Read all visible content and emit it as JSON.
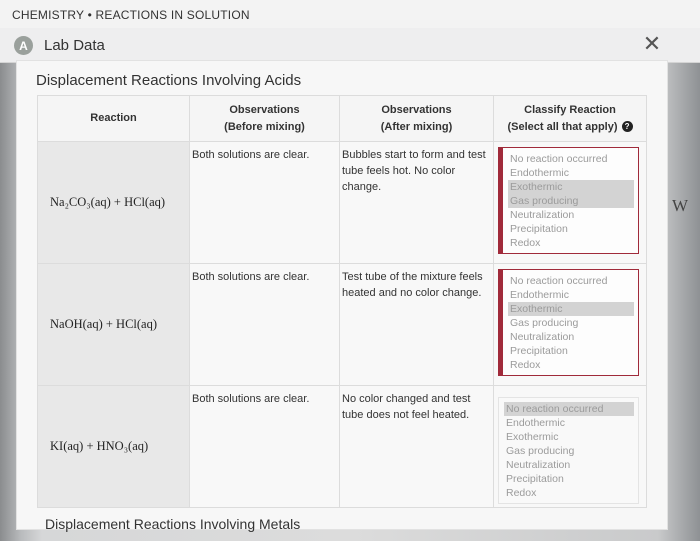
{
  "course_title": "CHEMISTRY • REACTIONS IN SOLUTION",
  "header": {
    "icon_letter": "A",
    "title": "Lab Data",
    "close": "✕"
  },
  "section_title": "Displacement Reactions Involving Acids",
  "columns": {
    "reaction": "Reaction",
    "before_1": "Observations",
    "before_2": "(Before mixing)",
    "after_1": "Observations",
    "after_2": "(After mixing)",
    "classify_1": "Classify Reaction",
    "classify_2": "(Select all that apply)",
    "help_icon": "?"
  },
  "rows": [
    {
      "reaction": "Na₂CO₃(aq) + HCl(aq)",
      "before": "Both solutions are clear.",
      "after": "Bubbles start to form and test tube feels hot. No color change.",
      "options": [
        "No reaction occurred",
        "Endothermic",
        "Exothermic",
        "Gas producing",
        "Neutralization",
        "Precipitation",
        "Redox"
      ],
      "selected": [
        "Exothermic",
        "Gas producing"
      ]
    },
    {
      "reaction": "NaOH(aq) + HCl(aq)",
      "before": "Both solutions are clear.",
      "after": "Test tube of the mixture feels heated and no color change.",
      "options": [
        "No reaction occurred",
        "Endothermic",
        "Exothermic",
        "Gas producing",
        "Neutralization",
        "Precipitation",
        "Redox"
      ],
      "selected": [
        "Exothermic"
      ]
    },
    {
      "reaction": "KI(aq) + HNO₃(aq)",
      "before": "Both solutions are clear.",
      "after": "No color changed and test tube does not feel heated.",
      "options": [
        "No reaction occurred",
        "Endothermic",
        "Exothermic",
        "Gas producing",
        "Neutralization",
        "Precipitation",
        "Redox"
      ],
      "selected": [
        "No reaction occurred"
      ]
    }
  ],
  "next_section_title": "Displacement Reactions Involving Metals",
  "side_text": "W"
}
